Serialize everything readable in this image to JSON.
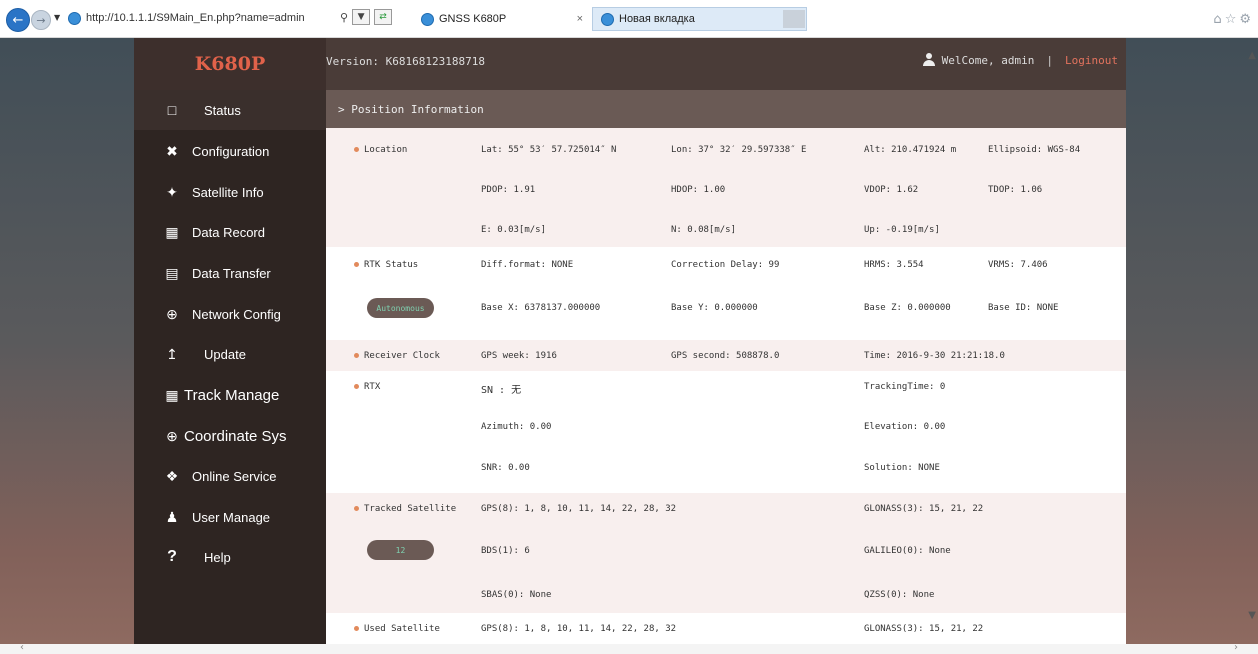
{
  "browser": {
    "url": "http://10.1.1.1/S9Main_En.php?name=admin",
    "tabs": [
      {
        "label": "GNSS K680P"
      },
      {
        "label": "Новая вкладка"
      }
    ]
  },
  "header": {
    "logo": "K680P",
    "version": "Version: K68168123188718",
    "welcome": "WelCome, admin",
    "separator": "|",
    "logout": "Loginout"
  },
  "sidebar": {
    "items": [
      {
        "label": "Status",
        "icon": "monitor-icon"
      },
      {
        "label": "Configuration",
        "icon": "tools-icon"
      },
      {
        "label": "Satellite Info",
        "icon": "satellite-icon"
      },
      {
        "label": "Data Record",
        "icon": "calendar-icon"
      },
      {
        "label": "Data Transfer",
        "icon": "transfer-icon"
      },
      {
        "label": "Network Config",
        "icon": "globe-icon"
      },
      {
        "label": "Update",
        "icon": "upload-icon"
      },
      {
        "label": "Track Manage",
        "icon": "calendar-icon"
      },
      {
        "label": "Coordinate Sys",
        "icon": "globe-icon"
      },
      {
        "label": "Online Service",
        "icon": "cube-icon"
      },
      {
        "label": "User Manage",
        "icon": "users-icon"
      },
      {
        "label": "Help",
        "icon": "question-icon"
      }
    ]
  },
  "main": {
    "section_title": "> Position Information",
    "location": {
      "label": "Location",
      "lat": "Lat: 55° 53′ 57.725014″ N",
      "lon": "Lon: 37° 32′ 29.597338″ E",
      "alt": "Alt: 210.471924 m",
      "ellipsoid": "Ellipsoid: WGS-84",
      "pdop": "PDOP: 1.91",
      "hdop": "HDOP: 1.00",
      "vdop": "VDOP: 1.62",
      "tdop": "TDOP: 1.06",
      "e": "E: 0.03[m/s]",
      "n": "N: 0.08[m/s]",
      "up": "Up: -0.19[m/s]"
    },
    "rtk": {
      "label": "RTK Status",
      "diff_format": "Diff.format: NONE",
      "correction_delay": "Correction Delay: 99",
      "hrms": "HRMS: 3.554",
      "vrms": "VRMS: 7.406",
      "mode_badge": "Autonomous",
      "base_x": "Base X: 6378137.000000",
      "base_y": "Base Y: 0.000000",
      "base_z": "Base Z: 0.000000",
      "base_id": "Base ID: NONE"
    },
    "clock": {
      "label": "Receiver Clock",
      "gps_week": "GPS week: 1916",
      "gps_second": "GPS second: 508878.0",
      "time": "Time: 2016-9-30 21:21:18.0"
    },
    "rtx": {
      "label": "RTX",
      "sn": "SN : 无",
      "tracking_time": "TrackingTime: 0",
      "azimuth": "Azimuth: 0.00",
      "elevation": "Elevation: 0.00",
      "snr": "SNR: 0.00",
      "solution": "Solution: NONE"
    },
    "tracked": {
      "label": "Tracked Satellite",
      "count_badge": "12",
      "gps": "GPS(8): 1, 8, 10, 11, 14, 22, 28, 32",
      "glonass": "GLONASS(3): 15, 21, 22",
      "bds": "BDS(1): 6",
      "galileo": "GALILEO(0): None",
      "sbas": "SBAS(0): None",
      "qzss": "QZSS(0): None"
    },
    "used": {
      "label": "Used Satellite",
      "gps": "GPS(8): 1, 8, 10, 11, 14, 22, 28, 32",
      "glonass": "GLONASS(3): 15, 21, 22"
    }
  }
}
